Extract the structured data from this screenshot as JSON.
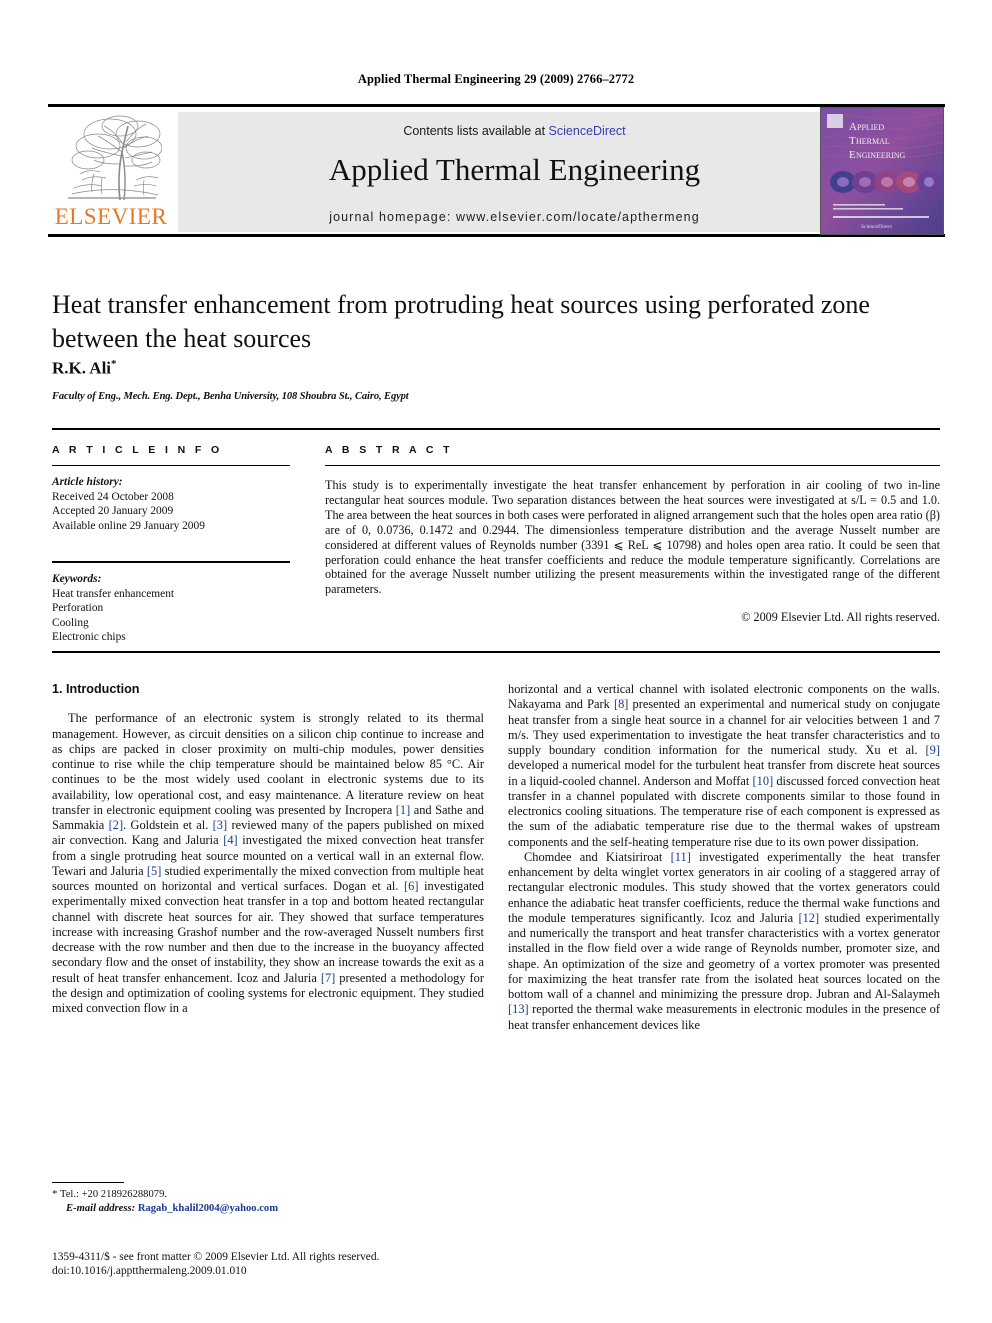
{
  "running_head": "Applied Thermal Engineering 29 (2009) 2766–2772",
  "header": {
    "contents_prefix": "Contents lists available at ",
    "sciencedirect": "ScienceDirect",
    "journal_title": "Applied Thermal Engineering",
    "homepage": "journal homepage: www.elsevier.com/locate/apthermeng",
    "publisher_name": "ELSEVIER",
    "cover_lines": [
      "APPLIED",
      "THERMAL",
      "ENGINEERING"
    ],
    "link_color": "#3b3bb0",
    "publisher_color": "#E87722"
  },
  "article": {
    "title": "Heat transfer enhancement from protruding heat sources using perforated zone between the heat sources",
    "author": "R.K. Ali",
    "author_marker": "*",
    "affiliation": "Faculty of Eng., Mech. Eng. Dept., Benha University, 108 Shoubra St., Cairo, Egypt"
  },
  "info": {
    "heading": "A R T I C L E   I N F O",
    "history_label": "Article history:",
    "history": [
      "Received 24 October 2008",
      "Accepted 20 January 2009",
      "Available online 29 January 2009"
    ],
    "keywords_label": "Keywords:",
    "keywords": [
      "Heat transfer enhancement",
      "Perforation",
      "Cooling",
      "Electronic chips"
    ]
  },
  "abstract": {
    "heading": "A B S T R A C T",
    "text": "This study is to experimentally investigate the heat transfer enhancement by perforation in air cooling of two in-line rectangular heat sources module. Two separation distances between the heat sources were investigated at s/L = 0.5 and 1.0. The area between the heat sources in both cases were perforated in aligned arrangement such that the holes open area ratio (β) are of 0, 0.0736, 0.1472 and 0.2944. The dimensionless temperature distribution and the average Nusselt number are considered at different values of Reynolds number (3391 ⩽ ReL ⩽ 10798) and holes open area ratio. It could be seen that perforation could enhance the heat transfer coefficients and reduce the module temperature significantly. Correlations are obtained for the average Nusselt number utilizing the present measurements within the investigated range of the different parameters.",
    "copyright": "© 2009 Elsevier Ltd. All rights reserved."
  },
  "introduction": {
    "heading": "1. Introduction",
    "left_paragraph": "The performance of an electronic system is strongly related to its thermal management. However, as circuit densities on a silicon chip continue to increase and as chips are packed in closer proximity on multi-chip modules, power densities continue to rise while the chip temperature should be maintained below 85 °C. Air continues to be the most widely used coolant in electronic systems due to its availability, low operational cost, and easy maintenance. A literature review on heat transfer in electronic equipment cooling was presented by Incropera [1] and Sathe and Sammakia [2]. Goldstein et al. [3] reviewed many of the papers published on mixed air convection. Kang and Jaluria [4] investigated the mixed convection heat transfer from a single protruding heat source mounted on a vertical wall in an external flow. Tewari and Jaluria [5] studied experimentally the mixed convection from multiple heat sources mounted on horizontal and vertical surfaces. Dogan et al. [6] investigated experimentally mixed convection heat transfer in a top and bottom heated rectangular channel with discrete heat sources for air. They showed that surface temperatures increase with increasing Grashof number and the row-averaged Nusselt numbers first decrease with the row number and then due to the increase in the buoyancy affected secondary flow and the onset of instability, they show an increase towards the exit as a result of heat transfer enhancement. Icoz and Jaluria [7] presented a methodology for the design and optimization of cooling systems for electronic equipment. They studied mixed convection flow in a",
    "right_paragraph_1": "horizontal and a vertical channel with isolated electronic components on the walls. Nakayama and Park [8] presented an experimental and numerical study on conjugate heat transfer from a single heat source in a channel for air velocities between 1 and 7 m/s. They used experimentation to investigate the heat transfer characteristics and to supply boundary condition information for the numerical study. Xu et al. [9] developed a numerical model for the turbulent heat transfer from discrete heat sources in a liquid-cooled channel. Anderson and Moffat [10] discussed forced convection heat transfer in a channel populated with discrete components similar to those found in electronics cooling situations. The temperature rise of each component is expressed as the sum of the adiabatic temperature rise due to the thermal wakes of upstream components and the self-heating temperature rise due to its own power dissipation.",
    "right_paragraph_2": "Chomdee and Kiatsiriroat [11] investigated experimentally the heat transfer enhancement by delta winglet vortex generators in air cooling of a staggered array of rectangular electronic modules. This study showed that the vortex generators could enhance the adiabatic heat transfer coefficients, reduce the thermal wake functions and the module temperatures significantly. Icoz and Jaluria [12] studied experimentally and numerically the transport and heat transfer characteristics with a vortex generator installed in the flow field over a wide range of Reynolds number, promoter size, and shape. An optimization of the size and geometry of a vortex promoter was presented for maximizing the heat transfer rate from the isolated heat sources located on the bottom wall of a channel and minimizing the pressure drop. Jubran and Al-Salaymeh [13] reported the thermal wake measurements in electronic modules in the presence of heat transfer enhancement devices like"
  },
  "footnote": {
    "marker": "*",
    "tel": "Tel.: +20 218926288079.",
    "email_label": "E-mail address:",
    "email": "Ragab_khalil2004@yahoo.com",
    "email_color": "#1a3a8f"
  },
  "footer": {
    "issn_line": "1359-4311/$ - see front matter © 2009 Elsevier Ltd. All rights reserved.",
    "doi_line": "doi:10.1016/j.apptthermaleng.2009.01.010"
  }
}
